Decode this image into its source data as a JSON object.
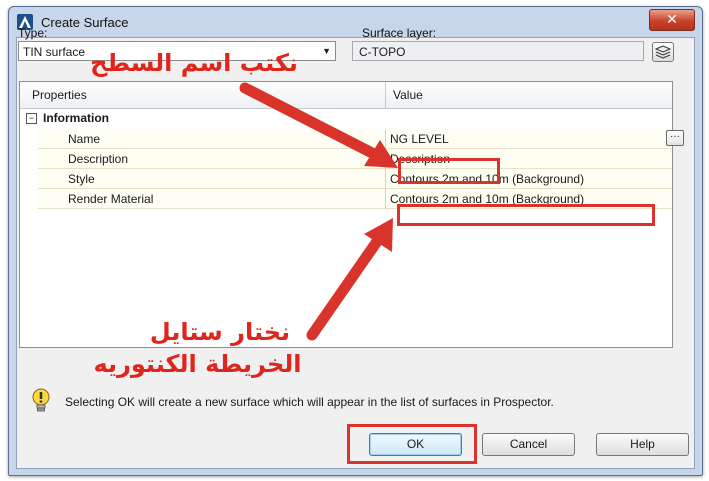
{
  "window": {
    "title": "Create Surface",
    "close_glyph": "✕"
  },
  "form": {
    "type_label": "Type:",
    "type_value": "TIN surface",
    "layer_label": "Surface layer:",
    "layer_value": "C-TOPO"
  },
  "grid": {
    "col_properties": "Properties",
    "col_value": "Value",
    "category": "Information",
    "category_expander": "−",
    "rows": [
      {
        "name": "Name",
        "value": "NG LEVEL"
      },
      {
        "name": "Description",
        "value": "Description"
      },
      {
        "name": "Style",
        "value": "Contours 2m and 10m (Background)"
      },
      {
        "name": "Render Material",
        "value": "Contours 2m and 10m (Background)"
      }
    ],
    "ellipsis": "···"
  },
  "info": {
    "message": "Selecting OK will create a new surface which will appear in the list of surfaces in Prospector."
  },
  "buttons": {
    "ok": "OK",
    "cancel": "Cancel",
    "help": "Help"
  },
  "annotations": {
    "top": "نكتب اسم السطح",
    "bottom_line1": "نختار ستايل",
    "bottom_line2": "الخريطة الكنتوريه",
    "color": "#e0261c"
  },
  "icons": {
    "app": "civil3d-logo-icon",
    "layer": "layer-stack-icon",
    "info": "lightbulb-icon"
  }
}
